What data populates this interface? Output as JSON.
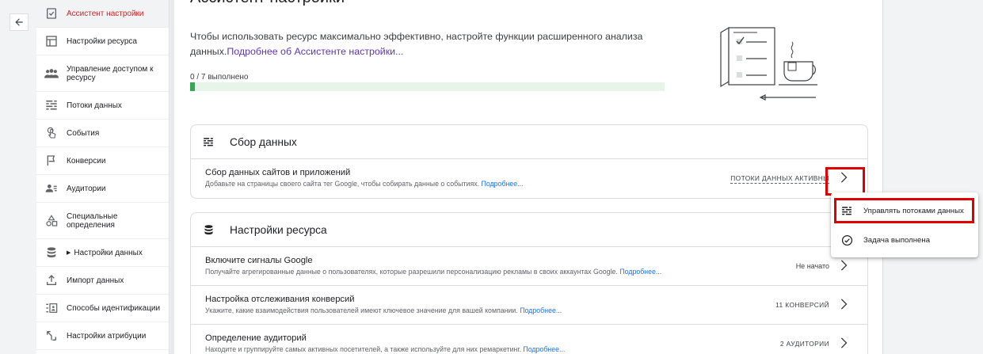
{
  "nav": {
    "back_label": "",
    "items": [
      {
        "label": "Ассистент настройки",
        "icon": "checklist-icon"
      },
      {
        "label": "Настройки ресурса",
        "icon": "layout-icon"
      },
      {
        "label": "Управление доступом к ресурсу",
        "icon": "people-icon"
      },
      {
        "label": "Потоки данных",
        "icon": "streams-icon"
      },
      {
        "label": "События",
        "icon": "touch-icon"
      },
      {
        "label": "Конверсии",
        "icon": "flag-icon"
      },
      {
        "label": "Аудитории",
        "icon": "audience-icon"
      },
      {
        "label": "Специальные определения",
        "icon": "shapes-icon"
      },
      {
        "label": "Настройки данных",
        "icon": "database-icon"
      },
      {
        "label": "Импорт данных",
        "icon": "upload-icon"
      },
      {
        "label": "Способы идентификации",
        "icon": "identity-icon"
      },
      {
        "label": "Настройки атрибуции",
        "icon": "attribution-icon"
      }
    ]
  },
  "main": {
    "title": "Ассистент настройки",
    "intro_text": "Чтобы использовать ресурс максимально эффективно, настройте функции расширенного анализа данных.",
    "intro_link": "Подробнее об Ассистенте настройки...",
    "progress_text": "0 / 7 выполнено",
    "progress_fraction": 0.01
  },
  "cards": [
    {
      "title": "Сбор данных",
      "icon": "streams-icon",
      "rows": [
        {
          "title": "Сбор данных сайтов и приложений",
          "subtitle": "Добавьте на страницы своего сайта тег Google, чтобы собирать данные о событиях.",
          "link": "Подробнее...",
          "status": "ПОТОКИ ДАННЫХ АКТИВНЫ"
        }
      ]
    },
    {
      "title": "Настройки ресурса",
      "icon": "database-icon",
      "rows": [
        {
          "title": "Включите сигналы Google",
          "subtitle": "Получайте агрегированные данные о пользователях, которые разрешили персонализацию рекламы в своих аккаунтах Google.",
          "link": "Подробнее...",
          "status": "Не начато"
        },
        {
          "title": "Настройка отслеживания конверсий",
          "subtitle": "Укажите, какие взаимодействия пользователей имеют ключевое значение для вашей компании.",
          "link": "Подробнее...",
          "status": "11 КОНВЕРСИЙ"
        },
        {
          "title": "Определение аудиторий",
          "subtitle": "Находите и группируйте самых активных посетителей, а также используйте для них ремаркетинг.",
          "link": "Подробнее...",
          "status": "2 АУДИТОРИИ"
        }
      ]
    }
  ],
  "menu": {
    "items": [
      {
        "label": "Управлять потоками данных",
        "icon": "streams-icon"
      },
      {
        "label": "Задача выполнена",
        "icon": "check-circle-icon"
      }
    ]
  },
  "colors": {
    "accent_active": "#c62828",
    "progress": "#34a853",
    "highlight": "#e00000",
    "link": "#1a73e8"
  }
}
